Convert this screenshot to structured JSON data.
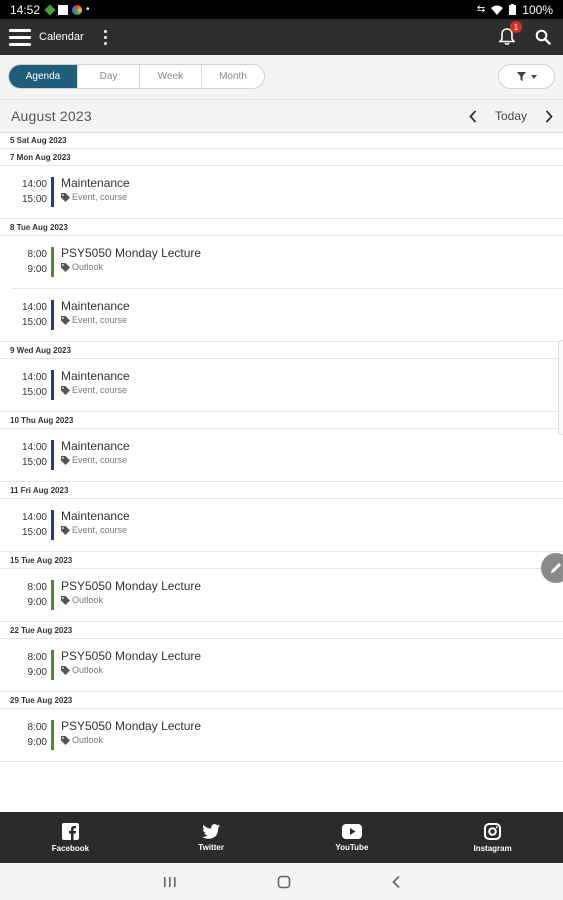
{
  "status_bar": {
    "time": "14:52",
    "battery": "100%"
  },
  "app_bar": {
    "title": "Calendar",
    "notification_count": "1"
  },
  "view_tabs": [
    {
      "label": "Agenda",
      "active": true
    },
    {
      "label": "Day",
      "active": false
    },
    {
      "label": "Week",
      "active": false
    },
    {
      "label": "Month",
      "active": false
    }
  ],
  "month_bar": {
    "title": "August 2023",
    "today_label": "Today"
  },
  "colors": {
    "maintenance": "#23388f",
    "lecture": "#4f8a2f",
    "active_tab": "#1f5d7a"
  },
  "agenda": {
    "partial_header": "5 Sat Aug 2023",
    "days": [
      {
        "header": "7 Mon Aug 2023",
        "events": [
          {
            "start": "14:00",
            "end": "15:00",
            "title": "Maintenance",
            "tags": "Event, course",
            "type": "maintenance"
          }
        ]
      },
      {
        "header": "8 Tue Aug 2023",
        "events": [
          {
            "start": "8:00",
            "end": "9:00",
            "title": "PSY5050 Monday Lecture",
            "tags": "Outlook",
            "type": "lecture"
          },
          {
            "start": "14:00",
            "end": "15:00",
            "title": "Maintenance",
            "tags": "Event, course",
            "type": "maintenance"
          }
        ]
      },
      {
        "header": "9 Wed Aug 2023",
        "events": [
          {
            "start": "14:00",
            "end": "15:00",
            "title": "Maintenance",
            "tags": "Event, course",
            "type": "maintenance"
          }
        ]
      },
      {
        "header": "10 Thu Aug 2023",
        "events": [
          {
            "start": "14:00",
            "end": "15:00",
            "title": "Maintenance",
            "tags": "Event, course",
            "type": "maintenance"
          }
        ]
      },
      {
        "header": "11 Fri Aug 2023",
        "events": [
          {
            "start": "14:00",
            "end": "15:00",
            "title": "Maintenance",
            "tags": "Event, course",
            "type": "maintenance"
          }
        ]
      },
      {
        "header": "15 Tue Aug 2023",
        "events": [
          {
            "start": "8:00",
            "end": "9:00",
            "title": "PSY5050 Monday Lecture",
            "tags": "Outlook",
            "type": "lecture"
          }
        ]
      },
      {
        "header": "22 Tue Aug 2023",
        "events": [
          {
            "start": "8:00",
            "end": "9:00",
            "title": "PSY5050 Monday Lecture",
            "tags": "Outlook",
            "type": "lecture"
          }
        ]
      },
      {
        "header": "29 Tue Aug 2023",
        "events": [
          {
            "start": "8:00",
            "end": "9:00",
            "title": "PSY5050 Monday Lecture",
            "tags": "Outlook",
            "type": "lecture"
          }
        ]
      }
    ]
  },
  "footer_links": [
    {
      "label": "Facebook",
      "icon": "facebook-icon"
    },
    {
      "label": "Twitter",
      "icon": "twitter-icon"
    },
    {
      "label": "YouTube",
      "icon": "youtube-icon"
    },
    {
      "label": "Instagram",
      "icon": "instagram-icon"
    }
  ]
}
